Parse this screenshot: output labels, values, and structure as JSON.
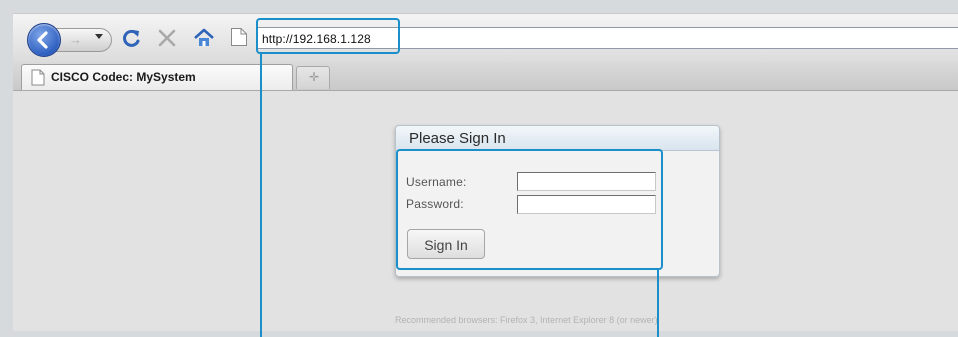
{
  "browser": {
    "url": "http://192.168.1.128",
    "tab_title": "CISCO Codec: MySystem"
  },
  "signin": {
    "title": "Please Sign In",
    "username_label": "Username:",
    "password_label": "Password:",
    "username_value": "",
    "password_value": "",
    "button_label": "Sign In"
  },
  "footer": {
    "recommended": "Recommended browsers: Firefox 3, Internet Explorer 8 (or newer)"
  },
  "colors": {
    "callout": "#1b8fc9",
    "back_button": "#2d5fc1"
  },
  "icons": [
    "back-arrow-icon",
    "forward-arrow-icon",
    "reload-icon",
    "stop-icon",
    "home-icon",
    "page-icon",
    "document-icon",
    "new-tab-plus-icon"
  ]
}
